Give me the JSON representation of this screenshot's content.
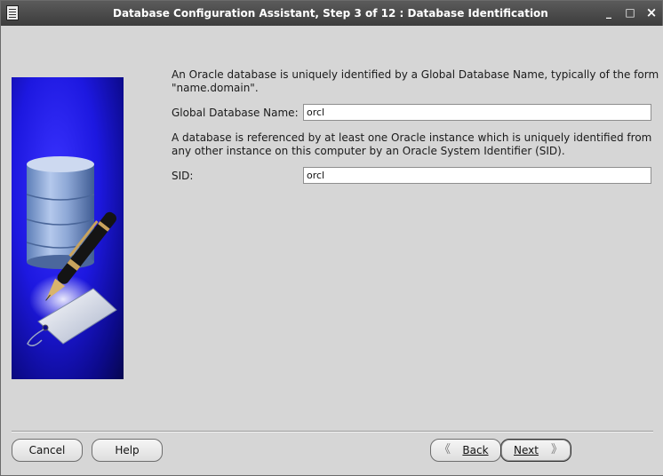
{
  "window": {
    "title": "Database Configuration Assistant, Step 3 of 12 : Database Identification",
    "controls": {
      "minimize": "_",
      "maximize": "□",
      "close": "×"
    }
  },
  "main": {
    "intro_line1": "An Oracle database is uniquely identified by a Global Database Name, typically of the form",
    "intro_line2": "\"name.domain\".",
    "global_db_label": "Global Database Name:",
    "global_db_value": "orcl",
    "sid_intro_line1": "A database is referenced by at least one Oracle instance which is uniquely identified from",
    "sid_intro_line2": "any other instance on this computer by an Oracle System Identifier (SID).",
    "sid_label": "SID:",
    "sid_value": "orcl"
  },
  "footer": {
    "cancel_label": "Cancel",
    "help_label": "Help",
    "back_label": "Back",
    "next_label": "Next",
    "back_icon": "chevron-left-icon",
    "next_icon": "chevron-right-icon"
  },
  "colors": {
    "titlebar": "#4a4a4a",
    "art_background": "#1d18e0",
    "window_background": "#d6d6d6"
  }
}
